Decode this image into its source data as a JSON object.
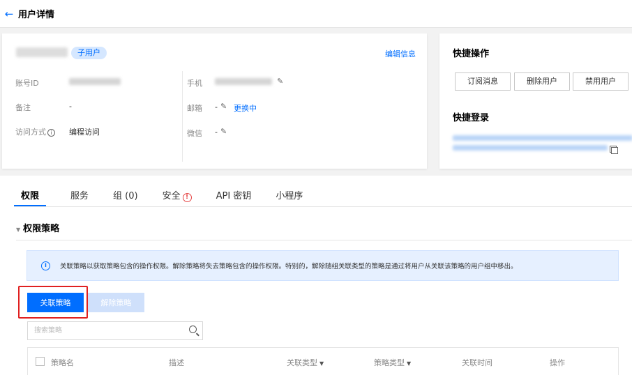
{
  "header": {
    "title": "用户详情"
  },
  "user": {
    "badge": "子用户",
    "edit_label": "编辑信息",
    "fields": {
      "account_id_label": "账号ID",
      "remark_label": "备注",
      "remark_value": "-",
      "access_label": "访问方式",
      "access_value": "编程访问",
      "phone_label": "手机",
      "email_label": "邮箱",
      "email_value": "-",
      "email_link": "更换中",
      "wechat_label": "微信",
      "wechat_value": "-"
    }
  },
  "quick": {
    "ops_title": "快捷操作",
    "buttons": [
      "订阅消息",
      "删除用户",
      "禁用用户"
    ],
    "login_title": "快捷登录"
  },
  "tabs": [
    "权限",
    "服务",
    "组 (0)",
    "安全",
    "API 密钥",
    "小程序"
  ],
  "section": {
    "title": "权限策略",
    "notice": "关联策略以获取策略包含的操作权限。解除策略将失去策略包含的操作权限。特别的，解除随组关联类型的策略是通过将用户从关联该策略的用户组中移出。",
    "attach_label": "关联策略",
    "detach_label": "解除策略",
    "search_placeholder": "搜索策略"
  },
  "table": {
    "columns": [
      "策略名",
      "描述",
      "关联类型",
      "策略类型",
      "关联时间",
      "操作"
    ]
  },
  "colors": {
    "accent": "#006eff",
    "highlight": "#e02020",
    "alert": "#e54545"
  }
}
